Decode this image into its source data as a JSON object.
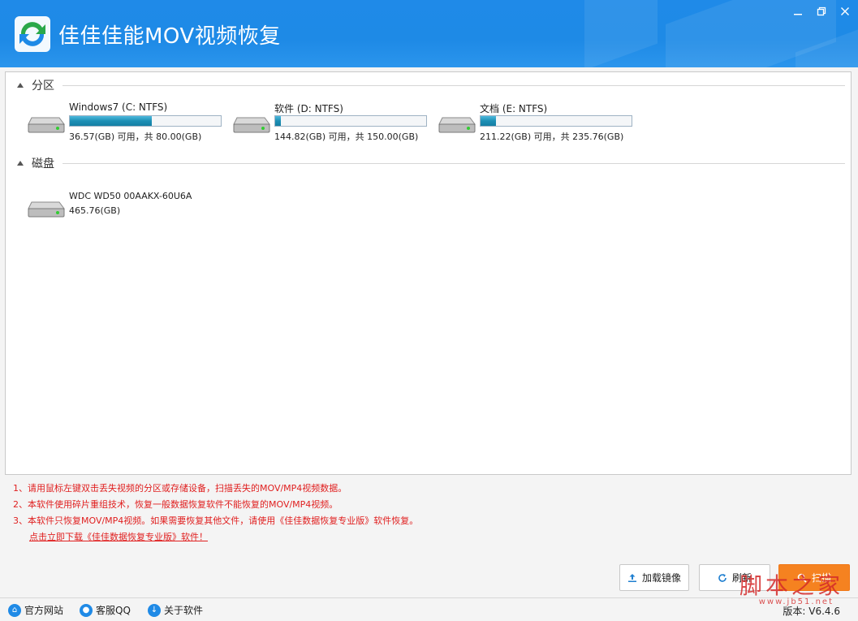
{
  "app": {
    "title": "佳佳佳能MOV视频恢复",
    "controls": [
      "minimize",
      "restore",
      "close"
    ]
  },
  "partitions": {
    "heading": "分区",
    "items": [
      {
        "name": "Windows7 (C: NTFS)",
        "info": "36.57(GB) 可用，共 80.00(GB)",
        "used_fraction": 0.543
      },
      {
        "name": "软件 (D: NTFS)",
        "info": "144.82(GB) 可用，共 150.00(GB)",
        "used_fraction": 0.035
      },
      {
        "name": "文档 (E: NTFS)",
        "info": "211.22(GB) 可用，共 235.76(GB)",
        "used_fraction": 0.104
      }
    ]
  },
  "disks": {
    "heading": "磁盘",
    "items": [
      {
        "name": "WDC WD50 00AAKX-60U6A",
        "info": "465.76(GB)"
      }
    ]
  },
  "notes": {
    "lines": [
      "1、请用鼠标左键双击丢失视频的分区或存储设备，扫描丢失的MOV/MP4视频数据。",
      "2、本软件使用碎片重组技术，恢复一般数据恢复软件不能恢复的MOV/MP4视频。",
      "3、本软件只恢复MOV/MP4视频。如果需要恢复其他文件，请使用《佳佳数据恢复专业版》软件恢复。"
    ],
    "download_link": "点击立即下载《佳佳数据恢复专业版》软件！"
  },
  "buttons": {
    "load_image": "加载镜像",
    "refresh": "刷新",
    "scan": "扫描"
  },
  "footer": {
    "official_site": "官方网站",
    "support_qq": "客服QQ",
    "about": "关于软件",
    "version": "版本: V6.4.6"
  },
  "watermark": {
    "text": "脚本之家",
    "sub": "www.jb51.net"
  },
  "colors": {
    "titlebar": "#1e8ae6",
    "progress": "#1d8fb5",
    "notes": "#e02020",
    "scan_button": "#f58220"
  }
}
